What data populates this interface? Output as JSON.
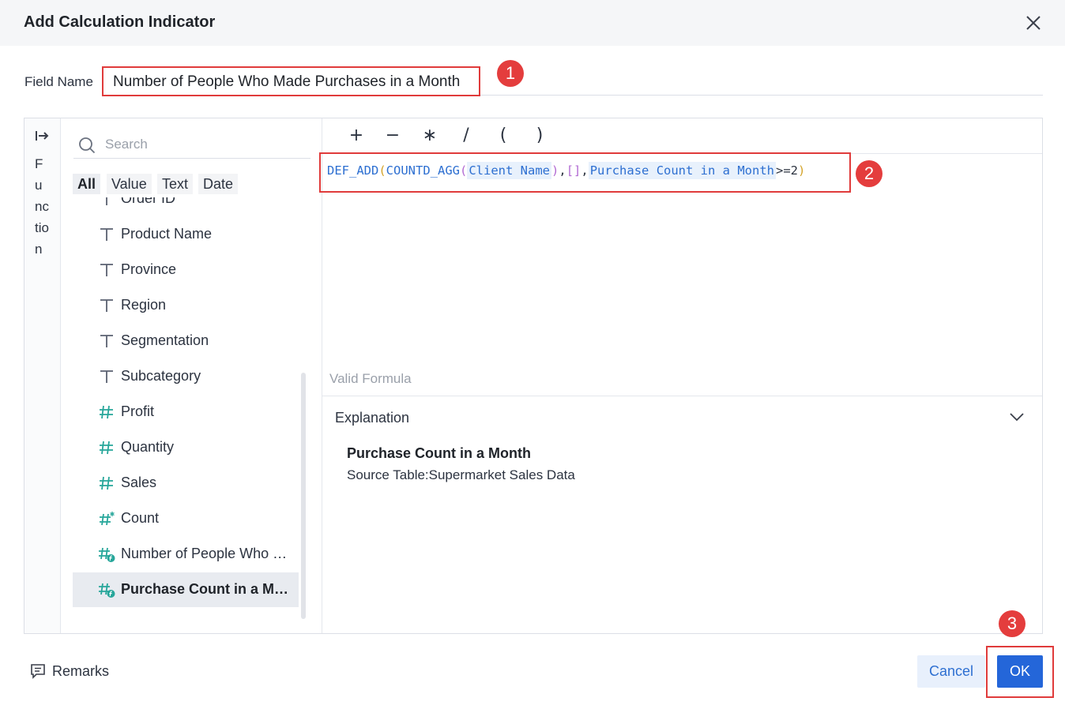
{
  "dialog": {
    "title": "Add Calculation Indicator"
  },
  "field_name": {
    "label": "Field Name",
    "value": "Number of People Who Made Purchases in a Month"
  },
  "annotations": {
    "badge_1": "1",
    "badge_2": "2",
    "badge_3": "3"
  },
  "function_panel": {
    "letters": [
      "F",
      "u",
      "nc",
      "tio",
      "n"
    ]
  },
  "fields_panel": {
    "search_placeholder": "Search",
    "filter_tabs": [
      "All",
      "Value",
      "Text",
      "Date"
    ],
    "active_tab": "All",
    "items": [
      {
        "label": "Order ID",
        "icon": "text-field-icon"
      },
      {
        "label": "Product Name",
        "icon": "text-field-icon"
      },
      {
        "label": "Province",
        "icon": "text-field-icon"
      },
      {
        "label": "Region",
        "icon": "text-field-icon"
      },
      {
        "label": "Segmentation",
        "icon": "text-field-icon"
      },
      {
        "label": "Subcategory",
        "icon": "text-field-icon"
      },
      {
        "label": "Profit",
        "icon": "number-field-icon"
      },
      {
        "label": "Quantity",
        "icon": "number-field-icon"
      },
      {
        "label": "Sales",
        "icon": "number-field-icon"
      },
      {
        "label": "Count",
        "icon": "count-field-icon"
      },
      {
        "label": "Number of People Who Made Purchases in a Month",
        "icon": "calculated-number-field-icon"
      },
      {
        "label": "Purchase Count in a Month",
        "icon": "calculated-number-field-icon",
        "selected": true
      }
    ]
  },
  "operators": [
    "+",
    "−",
    "∗",
    "/",
    "(",
    ")"
  ],
  "formula": {
    "fn1": "DEF_ADD",
    "open1": "(",
    "fn2": "COUNTD_AGG",
    "open2": "(",
    "field1": "Client Name",
    "close2": ")",
    "sep1": ",",
    "brackets": "[]",
    "sep2": ",",
    "field2": "Purchase Count in a Month",
    "tail": ">=2",
    "close1": ")"
  },
  "status": {
    "valid_text": "Valid Formula"
  },
  "explanation": {
    "title": "Explanation",
    "field_name": "Purchase Count in a Month",
    "source": "Source Table:Supermarket Sales Data"
  },
  "footer": {
    "remarks_label": "Remarks",
    "cancel_label": "Cancel",
    "ok_label": "OK"
  },
  "colors": {
    "accent": "#2466d9",
    "annotation_red": "#e43d3d",
    "text_field_icon": "#5a6170",
    "number_field_icon": "#26a69a"
  }
}
